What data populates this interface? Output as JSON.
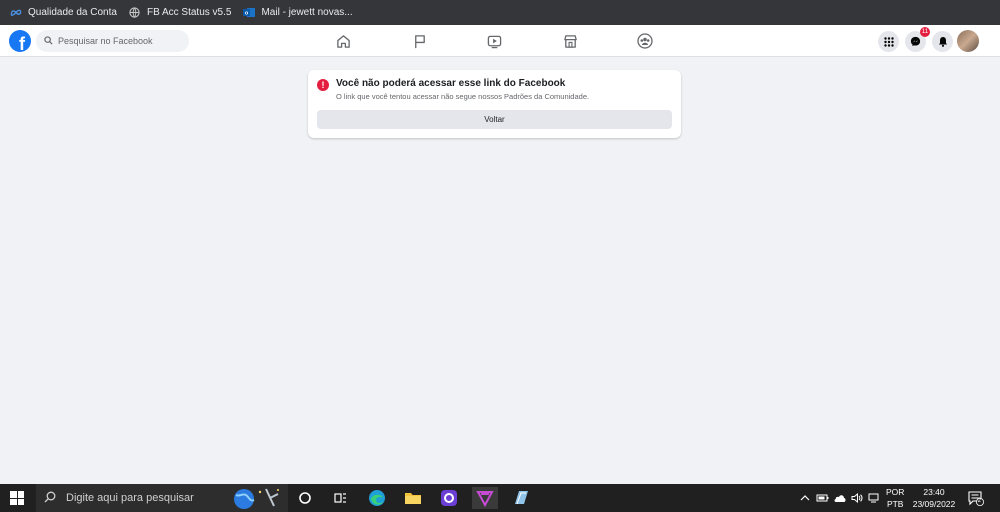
{
  "bookmarks": [
    {
      "label": "Qualidade da Conta",
      "icon": "meta-icon"
    },
    {
      "label": "FB Acc Status v5.5",
      "icon": "globe-icon"
    },
    {
      "label": "Mail - jewett novas...",
      "icon": "outlook-icon"
    }
  ],
  "header": {
    "search_placeholder": "Pesquisar no Facebook",
    "messenger_badge": "11"
  },
  "error_card": {
    "title": "Você não poderá acessar esse link do Facebook",
    "text": "O link que você tentou acessar não segue nossos Padrões da Comunidade.",
    "button": "Voltar"
  },
  "taskbar": {
    "search_placeholder": "Digite aqui para pesquisar",
    "lang_top": "POR",
    "lang_bottom": "PTB",
    "time": "23:40",
    "date": "23/09/2022",
    "notification_count": "2"
  },
  "colors": {
    "facebook_blue": "#1877f2",
    "error_red": "#e41e3f",
    "page_bg": "#f0f2f5"
  }
}
